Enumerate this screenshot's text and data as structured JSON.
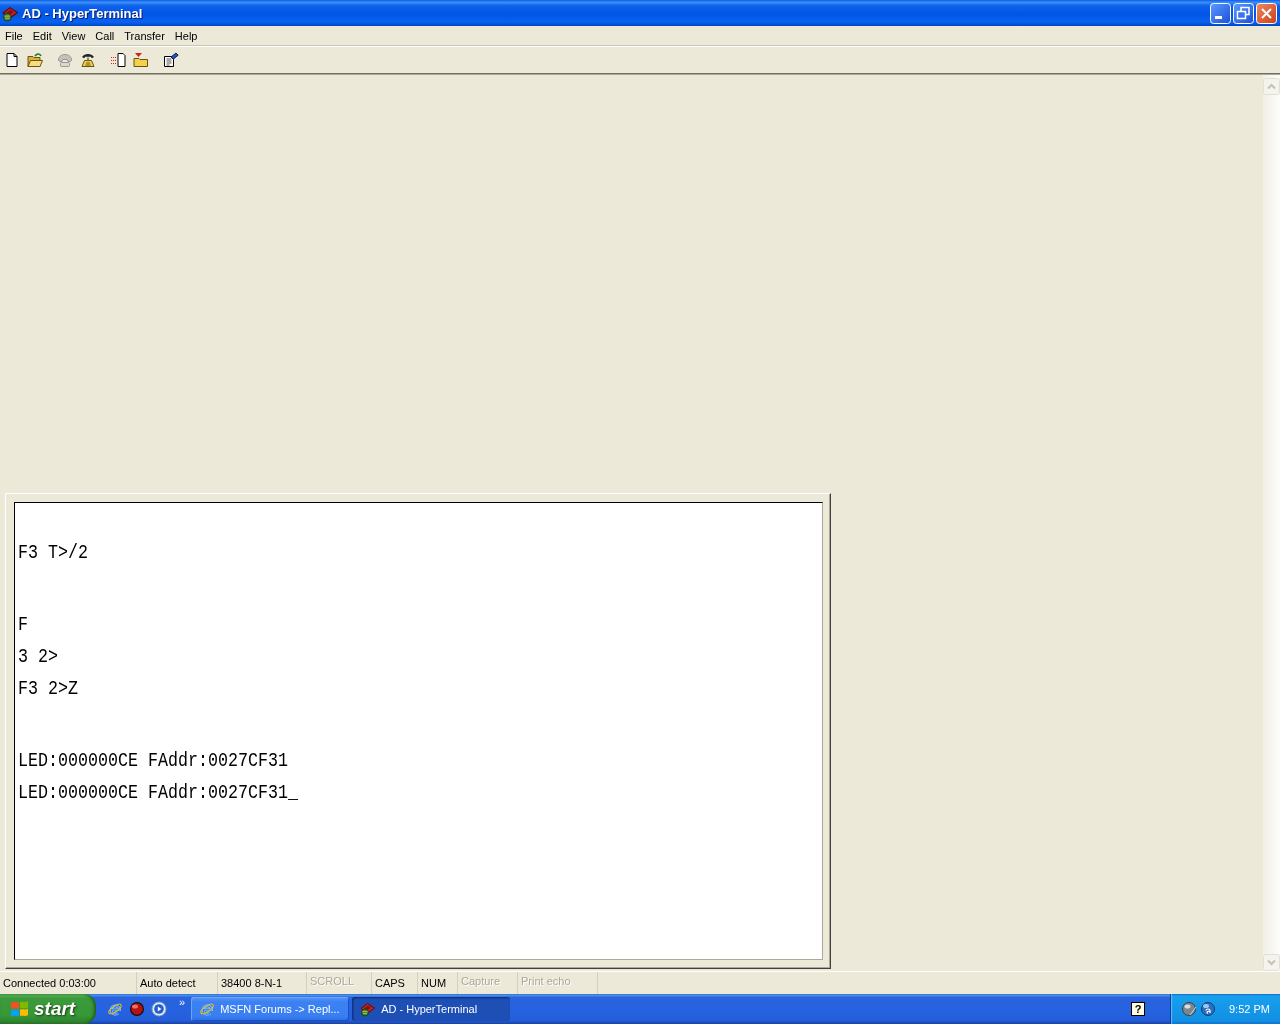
{
  "window": {
    "title": "AD - HyperTerminal"
  },
  "menu": [
    "File",
    "Edit",
    "View",
    "Call",
    "Transfer",
    "Help"
  ],
  "toolbar": [
    {
      "buttons": [
        {
          "kind": "new",
          "disabled": false
        },
        {
          "kind": "open",
          "disabled": false
        }
      ]
    },
    {
      "buttons": [
        {
          "kind": "phone",
          "disabled": true
        },
        {
          "kind": "handset",
          "disabled": false
        }
      ]
    },
    {
      "buttons": [
        {
          "kind": "send",
          "disabled": false
        },
        {
          "kind": "receive",
          "disabled": false
        }
      ]
    },
    {
      "buttons": [
        {
          "kind": "properties",
          "disabled": false
        }
      ]
    }
  ],
  "terminal": {
    "lines": [
      {
        "kind": "blank"
      },
      {
        "kind": "text",
        "text": "F3 T>/2"
      },
      {
        "kind": "blank"
      },
      {
        "kind": "text",
        "text": "F"
      },
      {
        "kind": "text",
        "text": "3 2>"
      },
      {
        "kind": "text",
        "text": "F3 2>Z"
      },
      {
        "kind": "blank"
      },
      {
        "kind": "text",
        "text": "LED:000000CE FAddr:0027CF31"
      },
      {
        "kind": "text",
        "text": "LED:000000CE FAddr:0027CF31_"
      }
    ]
  },
  "status_bar": [
    {
      "text": "Connected 0:03:00",
      "on": true
    },
    {
      "text": "Auto detect",
      "on": true
    },
    {
      "text": "38400 8-N-1",
      "on": true
    },
    {
      "text": "SCROLL",
      "on": false
    },
    {
      "text": "CAPS",
      "on": true
    },
    {
      "text": "NUM",
      "on": true
    },
    {
      "text": "Capture",
      "on": false
    },
    {
      "text": "Print echo",
      "on": false
    }
  ],
  "taskbar": {
    "start": "start",
    "overflow": "»",
    "tasks": [
      {
        "kind": "browser",
        "label": "MSFN Forums -> Repl...",
        "selected": false
      },
      {
        "kind": "terminal",
        "label": "AD - HyperTerminal",
        "selected": true
      }
    ],
    "help": "?",
    "clock": "9:52 PM"
  }
}
